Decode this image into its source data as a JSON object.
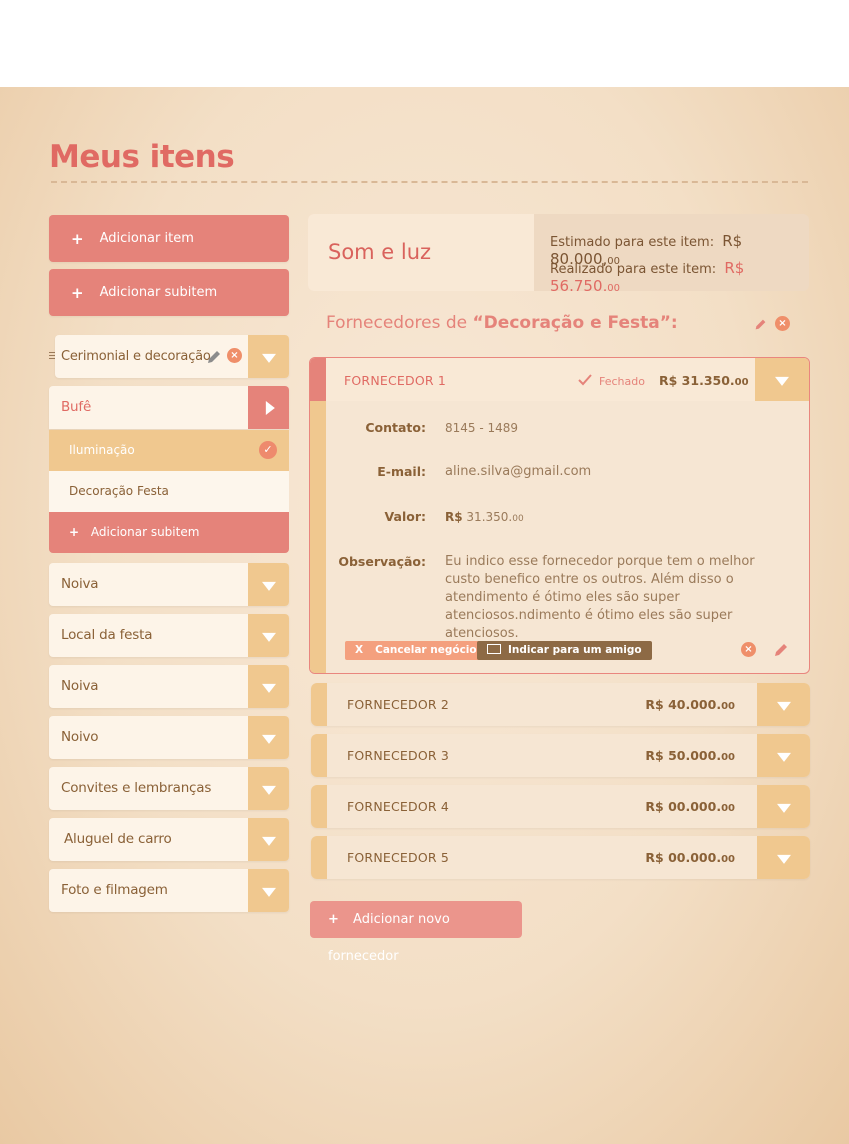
{
  "page": {
    "title": "Meus itens"
  },
  "sidebar": {
    "add_item": "Adicionar item",
    "add_subitem": "Adicionar subitem",
    "editing_category": {
      "label": "Cerimonial e decoração"
    },
    "active_category": {
      "label": "Bufê",
      "subitems": [
        {
          "label": "Iluminação",
          "selected": true
        },
        {
          "label": "Decoração Festa",
          "selected": false
        }
      ],
      "add_subitem": "Adicionar subitem"
    },
    "categories": [
      {
        "label": "Noiva"
      },
      {
        "label": "Local da festa"
      },
      {
        "label": "Noiva"
      },
      {
        "label": "Noivo"
      },
      {
        "label": "Convites e lembranças"
      },
      {
        "label": "Aluguel de carro"
      },
      {
        "label": "Foto e filmagem"
      }
    ]
  },
  "summary": {
    "item_name": "Som e luz",
    "estimated_label": "Estimado para este item:",
    "estimated_value": "R$ 80.000,",
    "estimated_cents": "00",
    "realized_label": "Realizado para este item:",
    "realized_value": "R$ 56.750,",
    "realized_cents": "00"
  },
  "suppliers_header": {
    "prefix": "Fornecedores de",
    "category": "“Decoração e Festa”:"
  },
  "open_supplier": {
    "name": "FORNECEDOR 1",
    "status": "Fechado",
    "price": "R$ 31.350.",
    "price_cents": "00",
    "contact_label": "Contato:",
    "contact_value": "8145 - 1489",
    "email_label": "E-mail:",
    "email_value": "aline.silva@gmail.com",
    "value_label": "Valor:",
    "value_currency": "R$",
    "value_amount": "31.350.",
    "value_cents": "00",
    "notes_label": "Observação:",
    "notes_value": "Eu indico esse fornecedor porque tem o melhor custo benefico entre os outros. Além disso o atendimento é ótimo eles são super atenciosos.ndimento é ótimo eles são super atenciosos.",
    "cancel_label": "Cancelar negócio",
    "cancel_glyph": "X",
    "recommend_label": "Indicar para um amigo"
  },
  "suppliers": [
    {
      "name": "FORNECEDOR 2",
      "price": "R$ 40.000.",
      "cents": "00"
    },
    {
      "name": "FORNECEDOR 3",
      "price": "R$ 50.000.",
      "cents": "00"
    },
    {
      "name": "FORNECEDOR 4",
      "price": "R$ 00.000.",
      "cents": "00"
    },
    {
      "name": "FORNECEDOR 5",
      "price": "R$ 00.000.",
      "cents": "00"
    }
  ],
  "add_supplier": "Adicionar novo fornecedor",
  "colors": {
    "accent_red": "#e5837a",
    "accent_orange": "#f0c88f",
    "text_brown": "#8a6137"
  }
}
